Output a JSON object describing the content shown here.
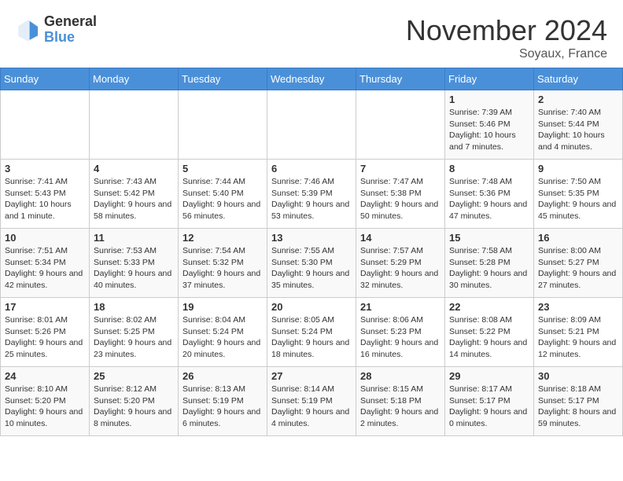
{
  "header": {
    "logo_general": "General",
    "logo_blue": "Blue",
    "month_title": "November 2024",
    "subtitle": "Soyaux, France"
  },
  "days_of_week": [
    "Sunday",
    "Monday",
    "Tuesday",
    "Wednesday",
    "Thursday",
    "Friday",
    "Saturday"
  ],
  "weeks": [
    [
      {
        "day": "",
        "info": ""
      },
      {
        "day": "",
        "info": ""
      },
      {
        "day": "",
        "info": ""
      },
      {
        "day": "",
        "info": ""
      },
      {
        "day": "",
        "info": ""
      },
      {
        "day": "1",
        "info": "Sunrise: 7:39 AM\nSunset: 5:46 PM\nDaylight: 10 hours and 7 minutes."
      },
      {
        "day": "2",
        "info": "Sunrise: 7:40 AM\nSunset: 5:44 PM\nDaylight: 10 hours and 4 minutes."
      }
    ],
    [
      {
        "day": "3",
        "info": "Sunrise: 7:41 AM\nSunset: 5:43 PM\nDaylight: 10 hours and 1 minute."
      },
      {
        "day": "4",
        "info": "Sunrise: 7:43 AM\nSunset: 5:42 PM\nDaylight: 9 hours and 58 minutes."
      },
      {
        "day": "5",
        "info": "Sunrise: 7:44 AM\nSunset: 5:40 PM\nDaylight: 9 hours and 56 minutes."
      },
      {
        "day": "6",
        "info": "Sunrise: 7:46 AM\nSunset: 5:39 PM\nDaylight: 9 hours and 53 minutes."
      },
      {
        "day": "7",
        "info": "Sunrise: 7:47 AM\nSunset: 5:38 PM\nDaylight: 9 hours and 50 minutes."
      },
      {
        "day": "8",
        "info": "Sunrise: 7:48 AM\nSunset: 5:36 PM\nDaylight: 9 hours and 47 minutes."
      },
      {
        "day": "9",
        "info": "Sunrise: 7:50 AM\nSunset: 5:35 PM\nDaylight: 9 hours and 45 minutes."
      }
    ],
    [
      {
        "day": "10",
        "info": "Sunrise: 7:51 AM\nSunset: 5:34 PM\nDaylight: 9 hours and 42 minutes."
      },
      {
        "day": "11",
        "info": "Sunrise: 7:53 AM\nSunset: 5:33 PM\nDaylight: 9 hours and 40 minutes."
      },
      {
        "day": "12",
        "info": "Sunrise: 7:54 AM\nSunset: 5:32 PM\nDaylight: 9 hours and 37 minutes."
      },
      {
        "day": "13",
        "info": "Sunrise: 7:55 AM\nSunset: 5:30 PM\nDaylight: 9 hours and 35 minutes."
      },
      {
        "day": "14",
        "info": "Sunrise: 7:57 AM\nSunset: 5:29 PM\nDaylight: 9 hours and 32 minutes."
      },
      {
        "day": "15",
        "info": "Sunrise: 7:58 AM\nSunset: 5:28 PM\nDaylight: 9 hours and 30 minutes."
      },
      {
        "day": "16",
        "info": "Sunrise: 8:00 AM\nSunset: 5:27 PM\nDaylight: 9 hours and 27 minutes."
      }
    ],
    [
      {
        "day": "17",
        "info": "Sunrise: 8:01 AM\nSunset: 5:26 PM\nDaylight: 9 hours and 25 minutes."
      },
      {
        "day": "18",
        "info": "Sunrise: 8:02 AM\nSunset: 5:25 PM\nDaylight: 9 hours and 23 minutes."
      },
      {
        "day": "19",
        "info": "Sunrise: 8:04 AM\nSunset: 5:24 PM\nDaylight: 9 hours and 20 minutes."
      },
      {
        "day": "20",
        "info": "Sunrise: 8:05 AM\nSunset: 5:24 PM\nDaylight: 9 hours and 18 minutes."
      },
      {
        "day": "21",
        "info": "Sunrise: 8:06 AM\nSunset: 5:23 PM\nDaylight: 9 hours and 16 minutes."
      },
      {
        "day": "22",
        "info": "Sunrise: 8:08 AM\nSunset: 5:22 PM\nDaylight: 9 hours and 14 minutes."
      },
      {
        "day": "23",
        "info": "Sunrise: 8:09 AM\nSunset: 5:21 PM\nDaylight: 9 hours and 12 minutes."
      }
    ],
    [
      {
        "day": "24",
        "info": "Sunrise: 8:10 AM\nSunset: 5:20 PM\nDaylight: 9 hours and 10 minutes."
      },
      {
        "day": "25",
        "info": "Sunrise: 8:12 AM\nSunset: 5:20 PM\nDaylight: 9 hours and 8 minutes."
      },
      {
        "day": "26",
        "info": "Sunrise: 8:13 AM\nSunset: 5:19 PM\nDaylight: 9 hours and 6 minutes."
      },
      {
        "day": "27",
        "info": "Sunrise: 8:14 AM\nSunset: 5:19 PM\nDaylight: 9 hours and 4 minutes."
      },
      {
        "day": "28",
        "info": "Sunrise: 8:15 AM\nSunset: 5:18 PM\nDaylight: 9 hours and 2 minutes."
      },
      {
        "day": "29",
        "info": "Sunrise: 8:17 AM\nSunset: 5:17 PM\nDaylight: 9 hours and 0 minutes."
      },
      {
        "day": "30",
        "info": "Sunrise: 8:18 AM\nSunset: 5:17 PM\nDaylight: 8 hours and 59 minutes."
      }
    ]
  ]
}
